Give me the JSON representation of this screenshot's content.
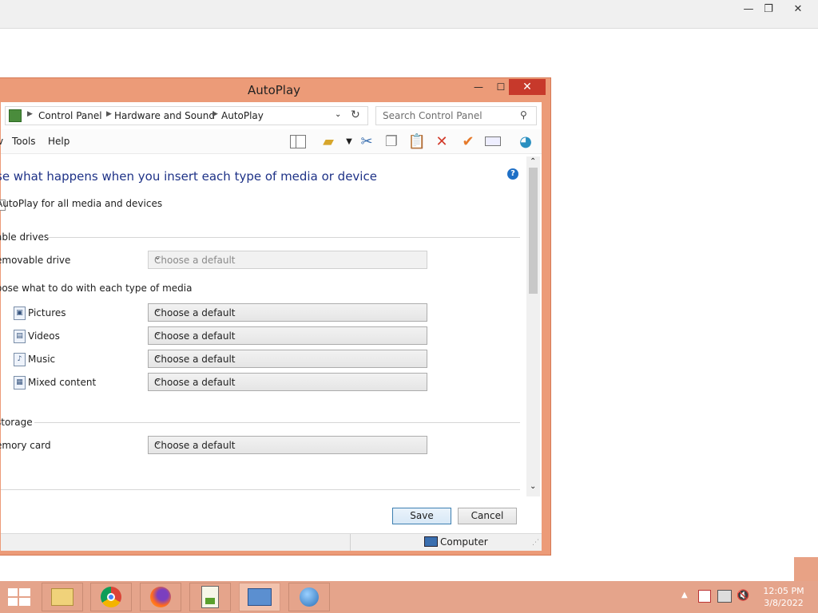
{
  "outer_window": {
    "controls": {
      "minimize": "—",
      "restore": "❐",
      "close": "✕"
    }
  },
  "autoplay_window": {
    "title": "AutoPlay",
    "controls": {
      "minimize": "—",
      "maximize": "☐",
      "close": "✕"
    },
    "address": {
      "crumbs": [
        "Control Panel",
        "Hardware and Sound",
        "AutoPlay"
      ]
    },
    "search": {
      "placeholder": "Search Control Panel"
    },
    "menus": [
      "v",
      "Tools",
      "Help"
    ],
    "toolbar_icons": [
      "layout-icon",
      "folder-properties-icon",
      "cut-icon",
      "copy-icon",
      "paste-icon",
      "delete-icon",
      "checkmark-icon",
      "rename-icon",
      "shell-icon"
    ],
    "content": {
      "heading": "se what happens when you insert each type of media or device",
      "use_autoplay": "AutoPlay for all media and devices",
      "removable_section": "able drives",
      "removable_drive_label": "emovable drive",
      "removable_drive_value": "Choose a default",
      "media_type_label": "oose what to do with each type of media",
      "media_items": [
        {
          "label": "Pictures",
          "value": "Choose a default"
        },
        {
          "label": "Videos",
          "value": "Choose a default"
        },
        {
          "label": "Music",
          "value": "Choose a default"
        },
        {
          "label": "Mixed content",
          "value": "Choose a default"
        }
      ],
      "storage_section": "storage",
      "memory_card_label": "emory card",
      "memory_card_value": "Choose a default"
    },
    "buttons": {
      "save": "Save",
      "cancel": "Cancel"
    },
    "statusbar": {
      "location": "Computer"
    }
  },
  "taskbar": {
    "apps": [
      "file-explorer",
      "chrome",
      "firefox",
      "notepad-plus-plus",
      "remote-desktop",
      "network-web"
    ],
    "clock": {
      "time": "12:05 PM",
      "date": "3/8/2022"
    }
  },
  "colors": {
    "window_frame": "#ec9b78",
    "close_button": "#c7392b",
    "taskbar": "#e5a48b",
    "heading": "#1e3287"
  }
}
